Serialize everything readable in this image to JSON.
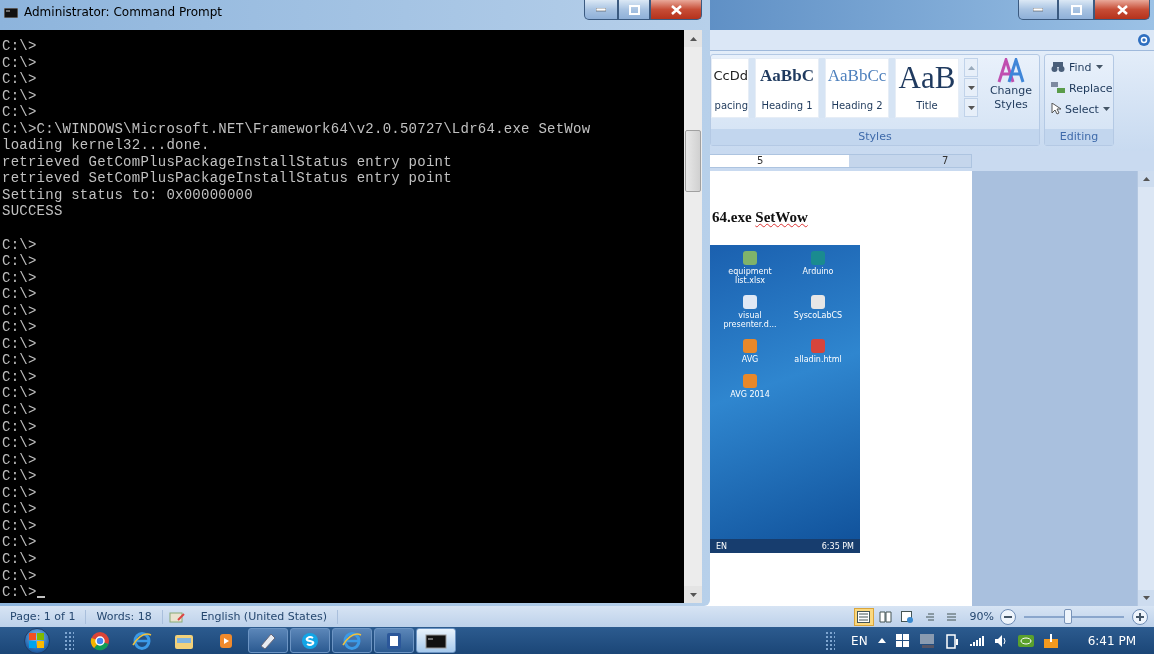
{
  "cmd": {
    "title": "Administrator: Command Prompt",
    "output": [
      "C:\\>",
      "C:\\>",
      "C:\\>",
      "C:\\>",
      "C:\\>",
      "C:\\>C:\\WINDOWS\\Microsoft.NET\\Framework64\\v2.0.50727\\Ldr64.exe SetWow",
      "loading kernel32...done.",
      "retrieved GetComPlusPackageInstallStatus entry point",
      "retrieved SetComPlusPackageInstallStatus entry point",
      "Setting status to: 0x00000000",
      "SUCCESS"
    ],
    "prompts": [
      "C:\\>",
      "C:\\>",
      "C:\\>",
      "C:\\>",
      "C:\\>",
      "C:\\>",
      "C:\\>",
      "C:\\>",
      "C:\\>",
      "C:\\>",
      "C:\\>",
      "C:\\>",
      "C:\\>",
      "C:\\>",
      "C:\\>",
      "C:\\>",
      "C:\\>",
      "C:\\>",
      "C:\\>",
      "C:\\>",
      "C:\\>",
      "C:\\>"
    ]
  },
  "word": {
    "styles_gallery": [
      {
        "sample": "CcDd",
        "label": "pacing",
        "kind": "normal"
      },
      {
        "sample": "AaBbC",
        "label": "Heading 1",
        "kind": "heading1"
      },
      {
        "sample": "AaBbCc",
        "label": "Heading 2",
        "kind": "heading2"
      },
      {
        "sample": "AaB",
        "label": "Title",
        "kind": "title"
      }
    ],
    "change_styles": "Change Styles",
    "styles_group": "Styles",
    "editing": [
      {
        "label": "Find",
        "kind": "find",
        "has_menu": true
      },
      {
        "label": "Replace",
        "kind": "replace",
        "has_menu": false
      },
      {
        "label": "Select",
        "kind": "select",
        "has_menu": true
      }
    ],
    "editing_group": "Editing",
    "ruler": [
      "5",
      "7"
    ],
    "heading": [
      {
        "text": "64.exe ",
        "misspelled": false
      },
      {
        "text": "SetWow",
        "misspelled": true
      }
    ],
    "embedded_screenshot": {
      "icons": [
        {
          "label": "equipment list.xlsx",
          "kind": "sheet"
        },
        {
          "label": "Arduino",
          "kind": "arduino"
        },
        {
          "label": "visual presenter.d...",
          "kind": "doc"
        },
        {
          "label": "SyscoLabCS",
          "kind": "camera"
        },
        {
          "label": "AVG",
          "kind": "avg"
        },
        {
          "label": "alladin.html",
          "kind": "chrome"
        },
        {
          "label": "AVG 2014",
          "kind": "avg"
        }
      ],
      "language": "EN",
      "clock": "6:35 PM"
    },
    "status": {
      "page": "Page: 1 of 1",
      "words": "Words: 18",
      "language": "English (United States)"
    },
    "view_buttons": [
      {
        "kind": "print",
        "selected": true
      },
      {
        "kind": "reading",
        "selected": false
      },
      {
        "kind": "web",
        "selected": false
      },
      {
        "kind": "outline",
        "selected": false
      },
      {
        "kind": "draft",
        "selected": false
      }
    ],
    "zoom": {
      "reading": "90%",
      "level": 0.45
    }
  },
  "taskbar": {
    "apps": [
      {
        "kind": "chrome",
        "running": false,
        "active": false
      },
      {
        "kind": "ie",
        "running": false,
        "active": false
      },
      {
        "kind": "folder",
        "running": false,
        "active": false
      },
      {
        "kind": "media",
        "running": false,
        "active": false
      },
      {
        "kind": "pen",
        "running": true,
        "active": false
      },
      {
        "kind": "skype",
        "running": true,
        "active": false
      },
      {
        "kind": "ie",
        "running": true,
        "active": false
      },
      {
        "kind": "word",
        "running": true,
        "active": false
      },
      {
        "kind": "console",
        "running": true,
        "active": true
      }
    ],
    "language": "EN",
    "clock": "6:41 PM"
  }
}
